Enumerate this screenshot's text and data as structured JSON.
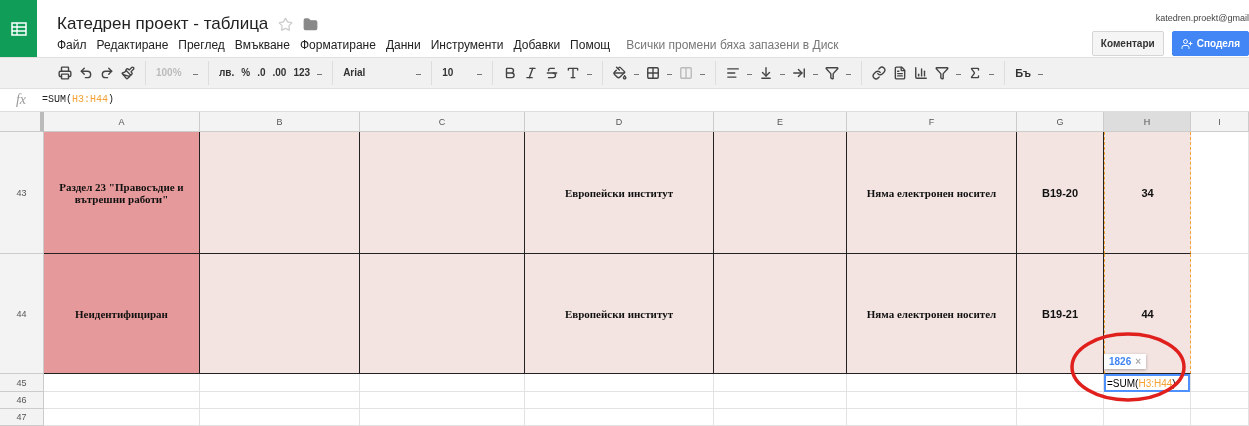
{
  "doc": {
    "title": "Катедрен проект - таблица",
    "starred": false,
    "save_status": "Всички промени бяха запазени в Диск",
    "account": "katedren.proekt@gmail"
  },
  "menu": [
    "Файл",
    "Редактиране",
    "Преглед",
    "Вмъкване",
    "Форматиране",
    "Данни",
    "Инструменти",
    "Добавки",
    "Помощ"
  ],
  "buttons": {
    "comments": "Коментари",
    "share": "Споделя"
  },
  "toolbar": {
    "zoom": {
      "text": "100%",
      "disabled": true
    },
    "currency": "лв.",
    "percent": "%",
    "decimal_less": ".0",
    "decimal_more": ".00",
    "number_format": "123",
    "font": "Arial",
    "font_size": "10",
    "input_tools": "Бъ"
  },
  "formula_bar": {
    "label": "fx",
    "prefix": "=SUM(",
    "ref": "H3:H44",
    "suffix": ")"
  },
  "columns": [
    {
      "label": "A",
      "selected": false
    },
    {
      "label": "B",
      "selected": false
    },
    {
      "label": "C",
      "selected": false
    },
    {
      "label": "D",
      "selected": false
    },
    {
      "label": "E",
      "selected": false
    },
    {
      "label": "F",
      "selected": false
    },
    {
      "label": "G",
      "selected": false
    },
    {
      "label": "H",
      "selected": true
    },
    {
      "label": "I",
      "selected": false
    }
  ],
  "rows": [
    {
      "number": "43",
      "cells": [
        {
          "text": "Раздел 23 \"Правосъдие и вътрешни работи\"",
          "highlight": true
        },
        {
          "text": ""
        },
        {
          "text": ""
        },
        {
          "text": "Европейски институт"
        },
        {
          "text": ""
        },
        {
          "text": "Няма електронен носител"
        },
        {
          "text": "B19-20"
        },
        {
          "text": "34",
          "in_range": true
        },
        {
          "text": ""
        }
      ]
    },
    {
      "number": "44",
      "cells": [
        {
          "text": "Неидентифициран",
          "highlight": true
        },
        {
          "text": ""
        },
        {
          "text": ""
        },
        {
          "text": "Европейски институт"
        },
        {
          "text": ""
        },
        {
          "text": "Няма електронен носител"
        },
        {
          "text": "B19-21"
        },
        {
          "text": "44",
          "in_range": true
        },
        {
          "text": ""
        }
      ]
    }
  ],
  "empty_rows": [
    "45",
    "46",
    "47"
  ],
  "edit_cell": {
    "prefix": "=SUM(",
    "ref": "H3:H44",
    "suffix": ")",
    "result": "1826",
    "close": "×"
  }
}
